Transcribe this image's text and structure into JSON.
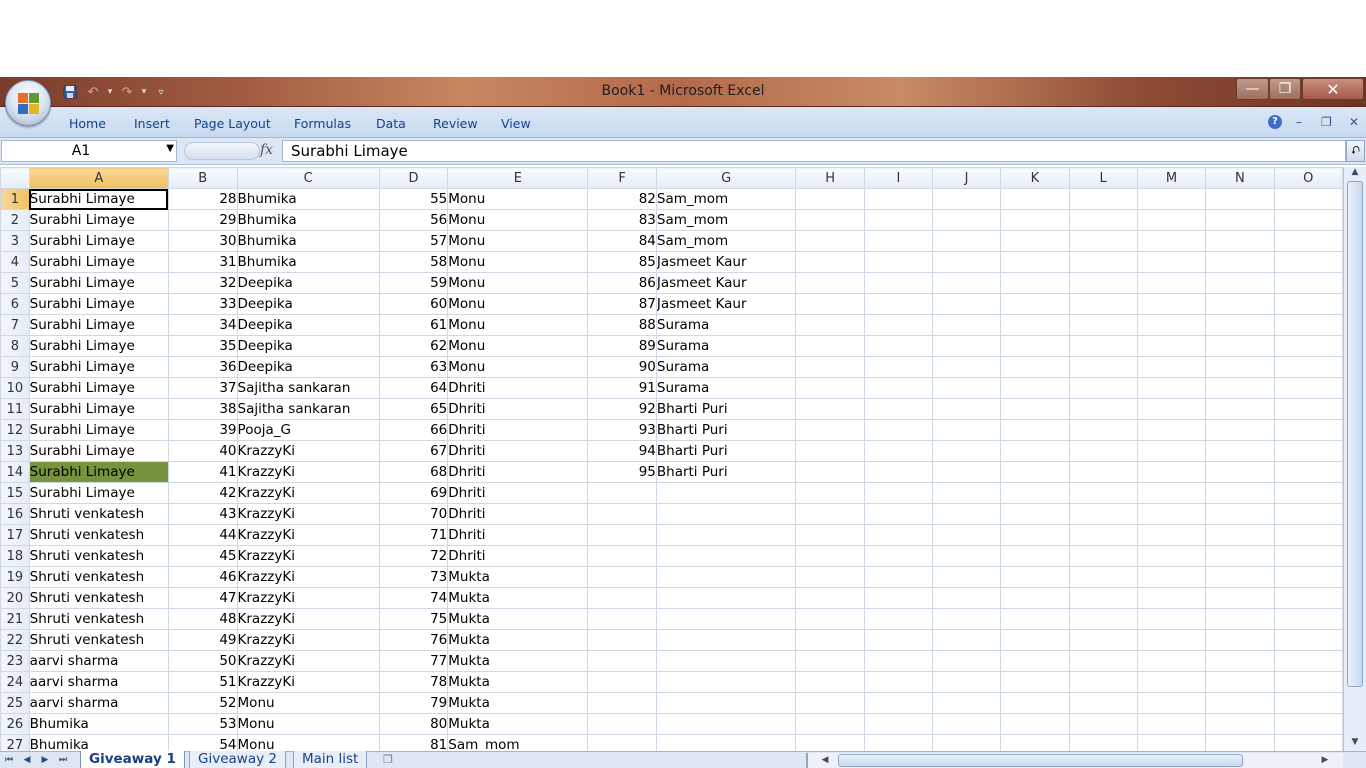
{
  "window": {
    "title": "Book1 - Microsoft Excel"
  },
  "icons": {
    "office_button": "office-logo-icon",
    "save": "save-icon",
    "undo": "undo-icon",
    "redo": "redo-icon",
    "customize": "customize-qat-icon",
    "minimize": "minimize-icon",
    "restore": "restore-icon",
    "close": "close-icon",
    "help": "help-icon"
  },
  "ribbon": {
    "tabs": [
      {
        "label": "Home"
      },
      {
        "label": "Insert"
      },
      {
        "label": "Page Layout"
      },
      {
        "label": "Formulas"
      },
      {
        "label": "Data"
      },
      {
        "label": "Review"
      },
      {
        "label": "View"
      }
    ],
    "help_glyph": "?"
  },
  "formula_bar": {
    "name_box": "A1",
    "fx_label": "fx",
    "formula": "Surabhi Limaye"
  },
  "grid": {
    "columns": [
      "A",
      "B",
      "C",
      "D",
      "E",
      "F",
      "G",
      "H",
      "I",
      "J",
      "K",
      "L",
      "M",
      "N",
      "O"
    ],
    "selected_column": "A",
    "active_cell": "A1",
    "highlighted_cell": "A14",
    "highlight_color": "#77933c",
    "rows": [
      {
        "n": "1",
        "A": "Surabhi Limaye",
        "B": "28",
        "C": "Bhumika",
        "D": "55",
        "E": "Monu",
        "F": "82",
        "G": "Sam_mom"
      },
      {
        "n": "2",
        "A": "Surabhi Limaye",
        "B": "29",
        "C": "Bhumika",
        "D": "56",
        "E": "Monu",
        "F": "83",
        "G": "Sam_mom"
      },
      {
        "n": "3",
        "A": "Surabhi Limaye",
        "B": "30",
        "C": "Bhumika",
        "D": "57",
        "E": "Monu",
        "F": "84",
        "G": "Sam_mom"
      },
      {
        "n": "4",
        "A": "Surabhi Limaye",
        "B": "31",
        "C": "Bhumika",
        "D": "58",
        "E": "Monu",
        "F": "85",
        "G": "Jasmeet Kaur"
      },
      {
        "n": "5",
        "A": "Surabhi Limaye",
        "B": "32",
        "C": "Deepika",
        "D": "59",
        "E": "Monu",
        "F": "86",
        "G": "Jasmeet Kaur"
      },
      {
        "n": "6",
        "A": "Surabhi Limaye",
        "B": "33",
        "C": "Deepika",
        "D": "60",
        "E": "Monu",
        "F": "87",
        "G": "Jasmeet Kaur"
      },
      {
        "n": "7",
        "A": "Surabhi Limaye",
        "B": "34",
        "C": "Deepika",
        "D": "61",
        "E": "Monu",
        "F": "88",
        "G": "Surama"
      },
      {
        "n": "8",
        "A": "Surabhi Limaye",
        "B": "35",
        "C": "Deepika",
        "D": "62",
        "E": "Monu",
        "F": "89",
        "G": "Surama"
      },
      {
        "n": "9",
        "A": "Surabhi Limaye",
        "B": "36",
        "C": "Deepika",
        "D": "63",
        "E": "Monu",
        "F": "90",
        "G": "Surama"
      },
      {
        "n": "10",
        "A": "Surabhi Limaye",
        "B": "37",
        "C": "Sajitha sankaran",
        "D": "64",
        "E": "Dhriti",
        "F": "91",
        "G": "Surama"
      },
      {
        "n": "11",
        "A": "Surabhi Limaye",
        "B": "38",
        "C": "Sajitha sankaran",
        "D": "65",
        "E": "Dhriti",
        "F": "92",
        "G": "Bharti Puri"
      },
      {
        "n": "12",
        "A": "Surabhi Limaye",
        "B": "39",
        "C": "Pooja_G",
        "D": "66",
        "E": "Dhriti",
        "F": "93",
        "G": "Bharti Puri"
      },
      {
        "n": "13",
        "A": "Surabhi Limaye",
        "B": "40",
        "C": "KrazzyKi",
        "D": "67",
        "E": "Dhriti",
        "F": "94",
        "G": "Bharti Puri"
      },
      {
        "n": "14",
        "A": "Surabhi Limaye",
        "B": "41",
        "C": "KrazzyKi",
        "D": "68",
        "E": "Dhriti",
        "F": "95",
        "G": "Bharti Puri"
      },
      {
        "n": "15",
        "A": "Surabhi Limaye",
        "B": "42",
        "C": "KrazzyKi",
        "D": "69",
        "E": "Dhriti",
        "F": "",
        "G": ""
      },
      {
        "n": "16",
        "A": "Shruti venkatesh",
        "B": "43",
        "C": "KrazzyKi",
        "D": "70",
        "E": "Dhriti",
        "F": "",
        "G": ""
      },
      {
        "n": "17",
        "A": "Shruti venkatesh",
        "B": "44",
        "C": "KrazzyKi",
        "D": "71",
        "E": "Dhriti",
        "F": "",
        "G": ""
      },
      {
        "n": "18",
        "A": "Shruti venkatesh",
        "B": "45",
        "C": "KrazzyKi",
        "D": "72",
        "E": "Dhriti",
        "F": "",
        "G": ""
      },
      {
        "n": "19",
        "A": "Shruti venkatesh",
        "B": "46",
        "C": "KrazzyKi",
        "D": "73",
        "E": "Mukta",
        "F": "",
        "G": ""
      },
      {
        "n": "20",
        "A": "Shruti venkatesh",
        "B": "47",
        "C": "KrazzyKi",
        "D": "74",
        "E": "Mukta",
        "F": "",
        "G": ""
      },
      {
        "n": "21",
        "A": "Shruti venkatesh",
        "B": "48",
        "C": "KrazzyKi",
        "D": "75",
        "E": "Mukta",
        "F": "",
        "G": ""
      },
      {
        "n": "22",
        "A": "Shruti venkatesh",
        "B": "49",
        "C": "KrazzyKi",
        "D": "76",
        "E": "Mukta",
        "F": "",
        "G": ""
      },
      {
        "n": "23",
        "A": "aarvi sharma",
        "B": "50",
        "C": "KrazzyKi",
        "D": "77",
        "E": "Mukta",
        "F": "",
        "G": ""
      },
      {
        "n": "24",
        "A": "aarvi sharma",
        "B": "51",
        "C": "KrazzyKi",
        "D": "78",
        "E": "Mukta",
        "F": "",
        "G": ""
      },
      {
        "n": "25",
        "A": "aarvi sharma",
        "B": "52",
        "C": "Monu",
        "D": "79",
        "E": "Mukta",
        "F": "",
        "G": ""
      },
      {
        "n": "26",
        "A": "Bhumika",
        "B": "53",
        "C": "Monu",
        "D": "80",
        "E": "Mukta",
        "F": "",
        "G": ""
      },
      {
        "n": "27",
        "A": "Bhumika",
        "B": "54",
        "C": "Monu",
        "D": "81",
        "E": "Sam_mom",
        "F": "",
        "G": ""
      }
    ]
  },
  "sheet_tabs": [
    {
      "label": "Giveaway 1",
      "active": true
    },
    {
      "label": "Giveaway 2",
      "active": false
    },
    {
      "label": "Main list",
      "active": false
    }
  ]
}
